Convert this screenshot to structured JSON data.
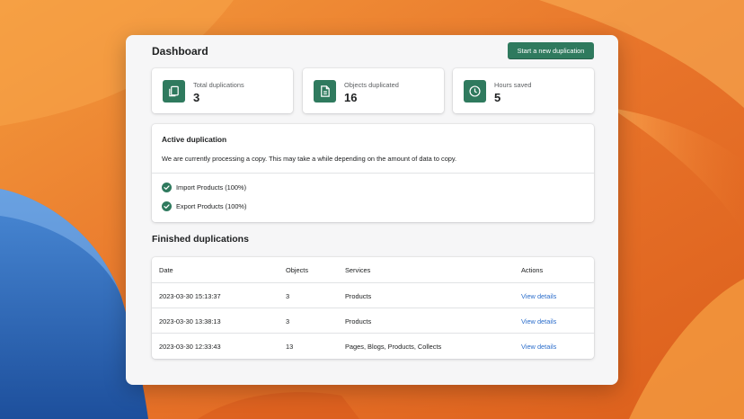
{
  "header": {
    "title": "Dashboard",
    "primary_action": "Start a new duplication"
  },
  "stats": [
    {
      "label": "Total duplications",
      "value": "3",
      "icon": "copy-icon"
    },
    {
      "label": "Objects duplicated",
      "value": "16",
      "icon": "document-icon"
    },
    {
      "label": "Hours saved",
      "value": "5",
      "icon": "clock-icon"
    }
  ],
  "active": {
    "title": "Active duplication",
    "description": "We are currently processing a copy. This may take a while depending on the amount of data to copy.",
    "tasks": [
      {
        "label": "Import Products (100%)",
        "progress": 1.0,
        "status": "complete"
      },
      {
        "label": "Export Products (100%)",
        "progress": 1.0,
        "status": "complete"
      }
    ]
  },
  "finished": {
    "title": "Finished duplications",
    "columns": [
      "Date",
      "Objects",
      "Services",
      "Actions"
    ],
    "rows": [
      {
        "date": "2023-03-30 15:13:37",
        "objects": "3",
        "services": "Products",
        "action": "View details"
      },
      {
        "date": "2023-03-30 13:38:13",
        "objects": "3",
        "services": "Products",
        "action": "View details"
      },
      {
        "date": "2023-03-30 12:33:43",
        "objects": "13",
        "services": "Pages, Blogs, Products, Collects",
        "action": "View details"
      }
    ]
  },
  "colors": {
    "accent": "#2f7a5e",
    "link": "#2c6ecb",
    "wallpaper_orange": "#e8742a",
    "wallpaper_blue": "#2c64b4"
  }
}
